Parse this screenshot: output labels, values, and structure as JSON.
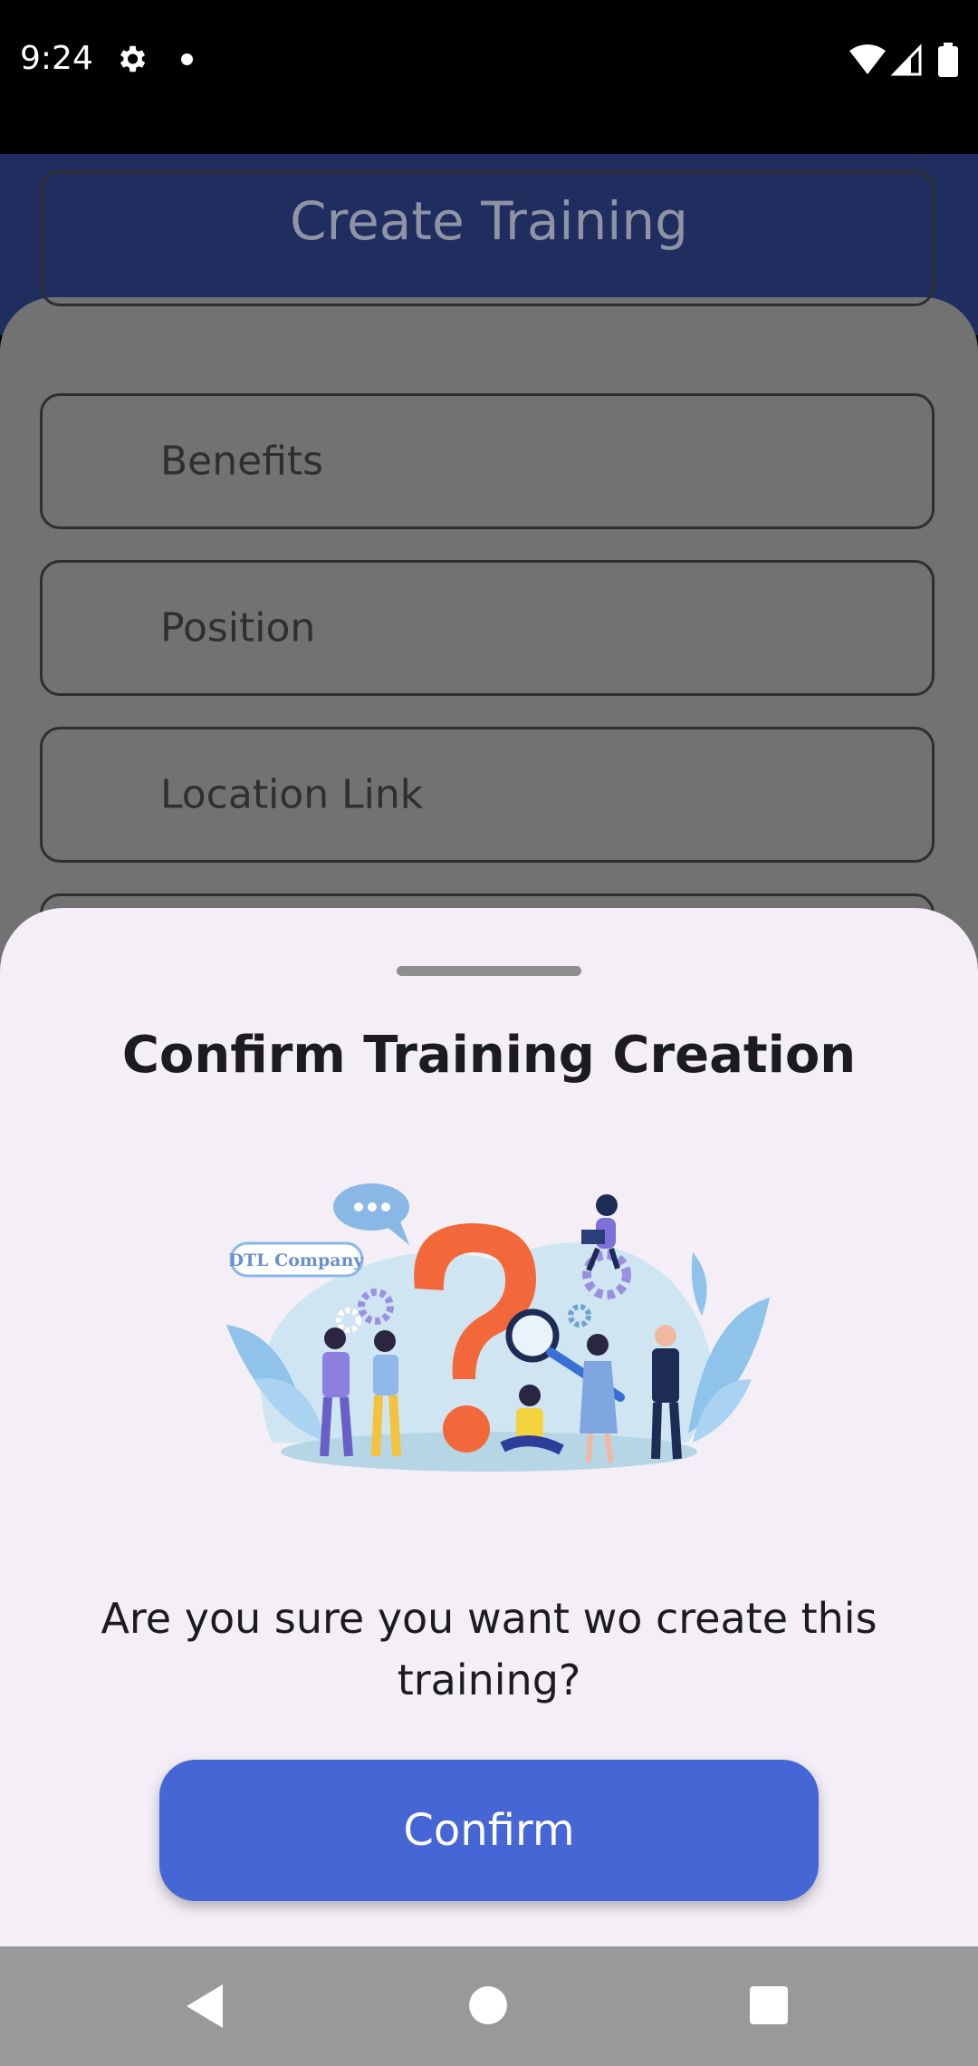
{
  "status_bar": {
    "time": "9:24",
    "icons": [
      "gear-icon",
      "notification-dot-icon",
      "wifi-icon",
      "cell-signal-icon",
      "battery-icon"
    ]
  },
  "header": {
    "title": "Create Training"
  },
  "form": {
    "fields": [
      {
        "label": ""
      },
      {
        "label": "Benefits"
      },
      {
        "label": "Position"
      },
      {
        "label": "Location Link"
      },
      {
        "label": ""
      }
    ]
  },
  "sheet": {
    "title": "Confirm Training Creation",
    "illustration_badge": "DTL Company",
    "message": "Are you sure you want wo create this training?",
    "confirm_label": "Confirm"
  },
  "colors": {
    "header_bg": "#1f2d5f",
    "scrim_panel": "#727272",
    "sheet_bg": "#f4eff6",
    "primary_button": "#4566d4",
    "question_mark": "#f2683a"
  },
  "nav_bar": {
    "icons": [
      "back-icon",
      "home-icon",
      "recents-icon"
    ]
  }
}
